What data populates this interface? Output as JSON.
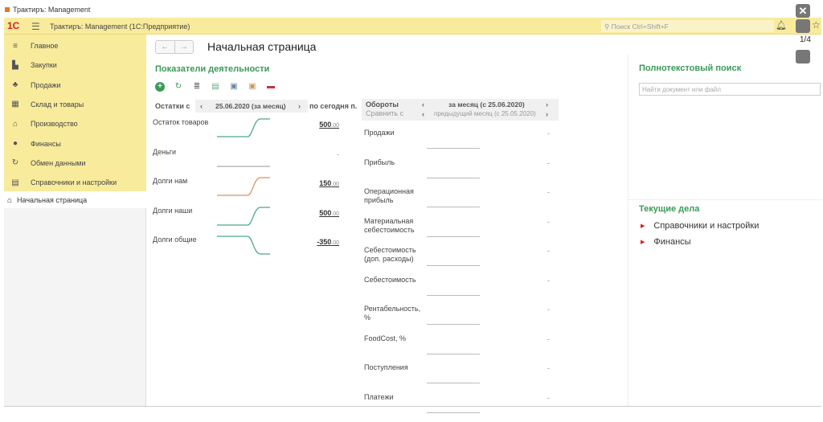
{
  "window": {
    "title": "Трактиръ: Management"
  },
  "appbar": {
    "logo": "1С",
    "title": "Трактиръ: Management  (1С:Предприятие)",
    "search_placeholder": "Поиск Ctrl+Shift+F"
  },
  "overlay": {
    "counter": "1/4"
  },
  "sidebar": {
    "items": [
      {
        "label": "Главное",
        "icon": "≡"
      },
      {
        "label": "Закупки",
        "icon": "▙"
      },
      {
        "label": "Продажи",
        "icon": "♣"
      },
      {
        "label": "Склад и товары",
        "icon": "▦"
      },
      {
        "label": "Производство",
        "icon": "⌂"
      },
      {
        "label": "Финансы",
        "icon": "●"
      },
      {
        "label": "Обмен данными",
        "icon": "↻"
      },
      {
        "label": "Справочники и настройки",
        "icon": "▤"
      }
    ],
    "home": "Начальная страница"
  },
  "page": {
    "title": "Начальная страница"
  },
  "kpi": {
    "title": "Показатели деятельности",
    "balance_label": "Остатки с",
    "balance_period": "25.06.2020 (за месяц)",
    "to_label": "по сегодня п.",
    "rows": [
      {
        "label": "Остаток товаров",
        "int": "500",
        "dec": ".00",
        "trend": "up",
        "color": "#4aa88a"
      },
      {
        "label": "Деньги",
        "int": "-",
        "dec": "",
        "trend": "flat",
        "color": "#aaaaaa"
      },
      {
        "label": "Долги нам",
        "int": "150",
        "dec": ".00",
        "trend": "up",
        "color": "#e0905a"
      },
      {
        "label": "Долги наши",
        "int": "500",
        "dec": ".00",
        "trend": "up",
        "color": "#4aa88a"
      },
      {
        "label": "Долги общие",
        "int": "-350",
        "dec": ".00",
        "trend": "down",
        "color": "#4aa88a"
      }
    ],
    "turnover_label": "Обороты",
    "compare_label": "Сравнить с",
    "turnover_period": "за месяц (с 25.06.2020)",
    "compare_period": "предыдущий месяц (с 25.05.2020)",
    "turnover_rows": [
      "Продажи",
      "Прибыль",
      "Операционная прибыль",
      "Материальная себестоимость",
      "Себестоимость (доп. расходы)",
      "Себестоимость",
      "Рентабельность, %",
      "FoodCost, %",
      "Поступления",
      "Платежи"
    ],
    "dash": "-"
  },
  "fulltext": {
    "title": "Полнотекстовый поиск",
    "placeholder": "Найти документ или файл"
  },
  "tasks": {
    "title": "Текущие дела",
    "items": [
      "Справочники и настройки",
      "Финансы"
    ]
  }
}
